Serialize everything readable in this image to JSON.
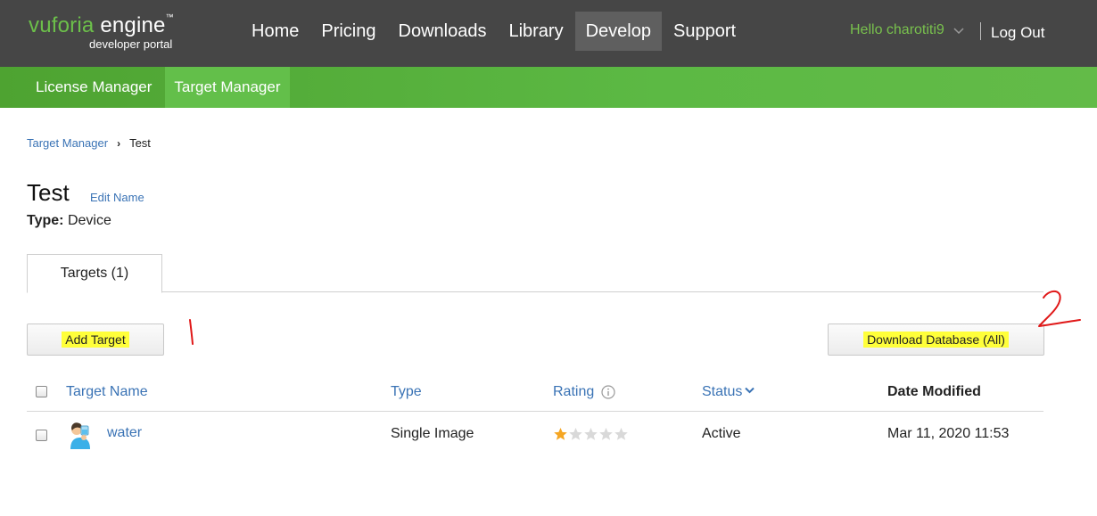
{
  "brand": {
    "name_v": "vuforia",
    "name_rest": "engine",
    "tm": "™",
    "subtitle": "developer portal"
  },
  "nav": {
    "items": [
      "Home",
      "Pricing",
      "Downloads",
      "Library",
      "Develop",
      "Support"
    ],
    "active": "Develop"
  },
  "user": {
    "greeting": "Hello charotiti9",
    "logout": "Log Out"
  },
  "subnav": {
    "items": [
      "License Manager",
      "Target Manager"
    ],
    "active": "Target Manager"
  },
  "breadcrumb": {
    "parent": "Target Manager",
    "current": "Test"
  },
  "database": {
    "name": "Test",
    "edit_link": "Edit Name",
    "type_label": "Type:",
    "type_value": "Device"
  },
  "tabs": [
    "Targets (1)"
  ],
  "actions": {
    "add_target": "Add Target",
    "download_database": "Download Database (All)"
  },
  "annotations": [
    "1",
    "2"
  ],
  "table": {
    "columns": [
      "Target Name",
      "Type",
      "Rating",
      "Status",
      "Date Modified"
    ],
    "sorted_column": "Status",
    "rows": [
      {
        "name": "water",
        "type": "Single Image",
        "rating": 1,
        "rating_max": 5,
        "status": "Active",
        "date_modified": "Mar 11, 2020 11:53"
      }
    ]
  },
  "colors": {
    "header_bg": "#464646",
    "brand_green": "#6cc04a",
    "subnav_green": "#5cb944",
    "link_blue": "#3a73b5",
    "highlight": "#ffff3a",
    "annotation_red": "#e01818",
    "star_filled": "#f5a623",
    "star_empty": "#d9d9d9"
  },
  "icons": {
    "user_menu": "chevron-down-icon",
    "rating_info": "info-icon",
    "status_sort": "chevron-down-icon",
    "row_thumbnail": "water-drinking-thumbnail"
  }
}
